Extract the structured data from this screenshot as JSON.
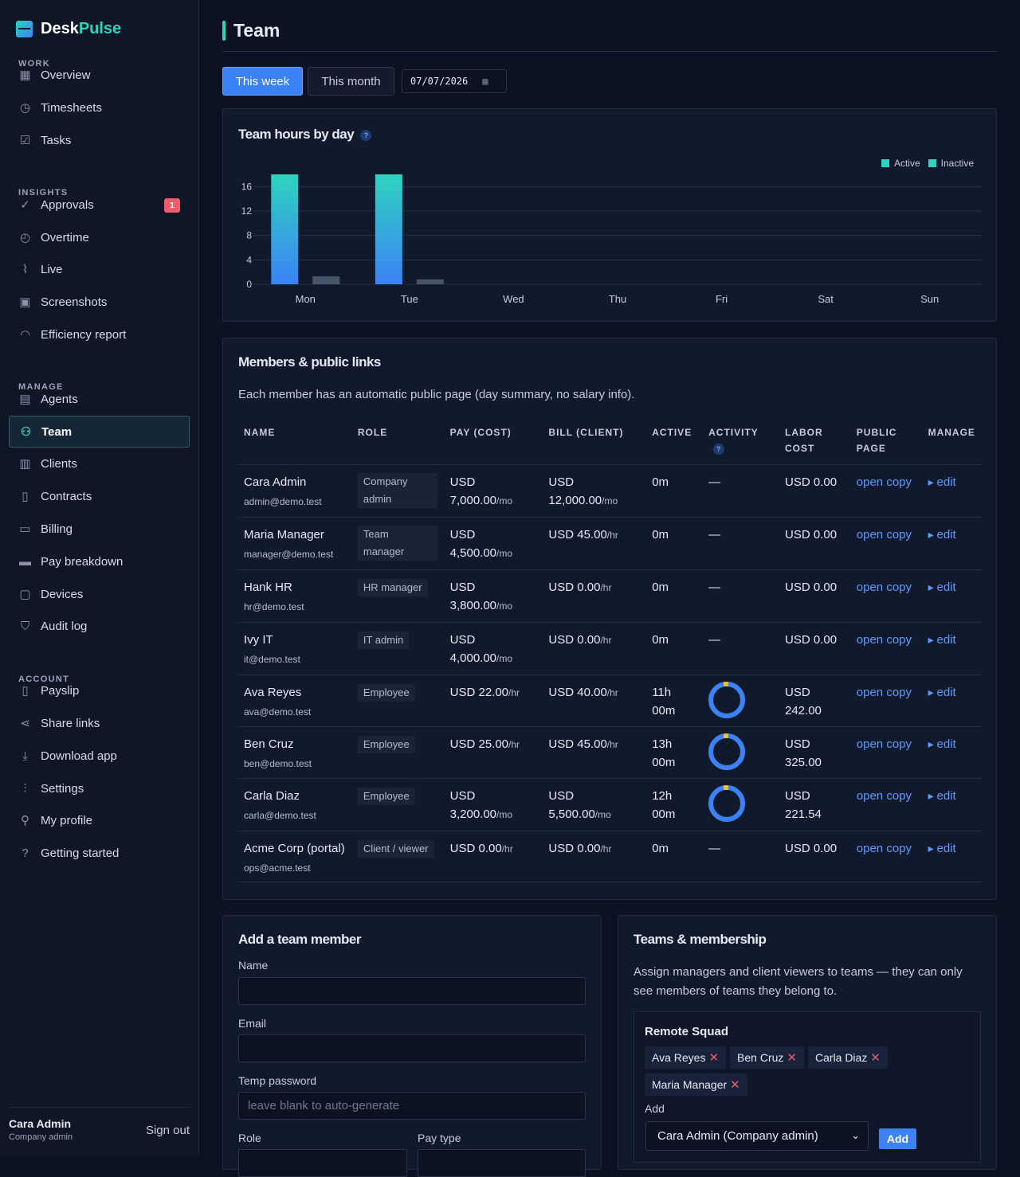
{
  "app": {
    "name_a": "Desk",
    "name_b": "Pulse"
  },
  "nav": {
    "sections": [
      "WORK",
      "INSIGHTS",
      "MANAGE",
      "ACCOUNT"
    ],
    "items": [
      {
        "label": "Overview",
        "icon": "grid-icon"
      },
      {
        "label": "Timesheets",
        "icon": "clock-icon"
      },
      {
        "label": "Tasks",
        "icon": "checkbox-icon"
      },
      {
        "label": "Approvals",
        "icon": "check-circle-icon",
        "badge": "1"
      },
      {
        "label": "Overtime",
        "icon": "alarm-icon"
      },
      {
        "label": "Live",
        "icon": "pulse-icon"
      },
      {
        "label": "Screenshots",
        "icon": "image-icon"
      },
      {
        "label": "Efficiency report",
        "icon": "gauge-icon"
      },
      {
        "label": "Agents",
        "icon": "id-card-icon"
      },
      {
        "label": "Team",
        "icon": "users-icon",
        "active": true
      },
      {
        "label": "Clients",
        "icon": "briefcase-icon"
      },
      {
        "label": "Contracts",
        "icon": "document-icon"
      },
      {
        "label": "Billing",
        "icon": "credit-card-icon"
      },
      {
        "label": "Pay breakdown",
        "icon": "money-icon"
      },
      {
        "label": "Devices",
        "icon": "monitor-icon"
      },
      {
        "label": "Audit log",
        "icon": "shield-icon"
      },
      {
        "label": "Payslip",
        "icon": "payslip-icon"
      },
      {
        "label": "Share links",
        "icon": "share-icon"
      },
      {
        "label": "Download app",
        "icon": "download-icon"
      },
      {
        "label": "Settings",
        "icon": "sliders-icon"
      },
      {
        "label": "My profile",
        "icon": "user-icon"
      },
      {
        "label": "Getting started",
        "icon": "help-icon"
      }
    ]
  },
  "user": {
    "name": "Cara Admin",
    "role": "Company admin",
    "signout": "Sign out"
  },
  "page": {
    "title": "Team",
    "this_week": "This week",
    "this_month": "This month",
    "date": "07/07/2026"
  },
  "chart": {
    "title": "Team hours by day",
    "legend_active": "Active",
    "legend_inactive": "Inactive",
    "help": "?"
  },
  "chart_data": {
    "type": "bar",
    "title": "Team hours by day",
    "categories": [
      "Mon",
      "Tue",
      "Wed",
      "Thu",
      "Fri",
      "Sat",
      "Sun"
    ],
    "series": [
      {
        "name": "Active",
        "values": [
          18,
          18,
          0,
          0,
          0,
          0,
          0
        ]
      },
      {
        "name": "Inactive",
        "values": [
          1.3,
          0.8,
          0,
          0,
          0,
          0,
          0
        ]
      }
    ],
    "yticks": [
      0,
      4,
      8,
      12,
      16
    ],
    "ylim": [
      0,
      18
    ],
    "grid": true,
    "legend": "top-right",
    "colors": {
      "active": "#2dd4bf",
      "inactive": "#475569"
    }
  },
  "members": {
    "title": "Members & public links",
    "desc": "Each member has an automatic public page (day summary, no salary info).",
    "headers": [
      "NAME",
      "ROLE",
      "PAY (COST)",
      "BILL (CLIENT)",
      "ACTIVE",
      "ACTIVITY",
      "LABOR COST",
      "PUBLIC PAGE",
      "MANAGE"
    ],
    "rows": [
      {
        "name": "Cara Admin",
        "email": "admin@demo.test",
        "role": "Company admin",
        "pay": "USD 7,000.00",
        "pay_unit": "/mo",
        "bill": "USD 12,000.00",
        "bill_unit": "/mo",
        "active": "0m",
        "activity": "—",
        "labor": "USD 0.00",
        "open": "open",
        "copy": "copy",
        "edit": "edit"
      },
      {
        "name": "Maria Manager",
        "email": "manager@demo.test",
        "role": "Team manager",
        "pay": "USD 4,500.00",
        "pay_unit": "/mo",
        "bill": "USD 45.00",
        "bill_unit": "/hr",
        "active": "0m",
        "activity": "—",
        "labor": "USD 0.00",
        "open": "open",
        "copy": "copy",
        "edit": "edit"
      },
      {
        "name": "Hank HR",
        "email": "hr@demo.test",
        "role": "HR manager",
        "pay": "USD 3,800.00",
        "pay_unit": "/mo",
        "bill": "USD 0.00",
        "bill_unit": "/hr",
        "active": "0m",
        "activity": "—",
        "labor": "USD 0.00",
        "open": "open",
        "copy": "copy",
        "edit": "edit"
      },
      {
        "name": "Ivy IT",
        "email": "it@demo.test",
        "role": "IT admin",
        "pay": "USD 4,000.00",
        "pay_unit": "/mo",
        "bill": "USD 0.00",
        "bill_unit": "/hr",
        "active": "0m",
        "activity": "—",
        "labor": "USD 0.00",
        "open": "open",
        "copy": "copy",
        "edit": "edit"
      },
      {
        "name": "Ava Reyes",
        "email": "ava@demo.test",
        "role": "Employee",
        "pay": "USD 22.00",
        "pay_unit": "/hr",
        "bill": "USD 40.00",
        "bill_unit": "/hr",
        "active": "11h 00m",
        "activity": "donut",
        "labor": "USD 242.00",
        "open": "open",
        "copy": "copy",
        "edit": "edit"
      },
      {
        "name": "Ben Cruz",
        "email": "ben@demo.test",
        "role": "Employee",
        "pay": "USD 25.00",
        "pay_unit": "/hr",
        "bill": "USD 45.00",
        "bill_unit": "/hr",
        "active": "13h 00m",
        "activity": "donut",
        "labor": "USD 325.00",
        "open": "open",
        "copy": "copy",
        "edit": "edit"
      },
      {
        "name": "Carla Diaz",
        "email": "carla@demo.test",
        "role": "Employee",
        "pay": "USD 3,200.00",
        "pay_unit": "/mo",
        "bill": "USD 5,500.00",
        "bill_unit": "/mo",
        "active": "12h 00m",
        "activity": "donut",
        "labor": "USD 221.54",
        "open": "open",
        "copy": "copy",
        "edit": "edit"
      },
      {
        "name": "Acme Corp (portal)",
        "email": "ops@acme.test",
        "role": "Client / viewer",
        "pay": "USD 0.00",
        "pay_unit": "/hr",
        "bill": "USD 0.00",
        "bill_unit": "/hr",
        "active": "0m",
        "activity": "—",
        "labor": "USD 0.00",
        "open": "open",
        "copy": "copy",
        "edit": "edit"
      }
    ]
  },
  "add_member": {
    "title": "Add a team member",
    "name_label": "Name",
    "email_label": "Email",
    "pw_label": "Temp password",
    "pw_placeholder": "leave blank to auto-generate",
    "role_label": "Role",
    "pay_type_label": "Pay type"
  },
  "teams": {
    "title": "Teams & membership",
    "desc": "Assign managers and client viewers to teams — they can only see members of teams they belong to.",
    "team_name": "Remote Squad",
    "members": [
      "Ava Reyes",
      "Ben Cruz",
      "Carla Diaz",
      "Maria Manager"
    ],
    "add_label": "Add",
    "select_value": "Cara Admin (Company admin)",
    "add_button": "Add"
  }
}
